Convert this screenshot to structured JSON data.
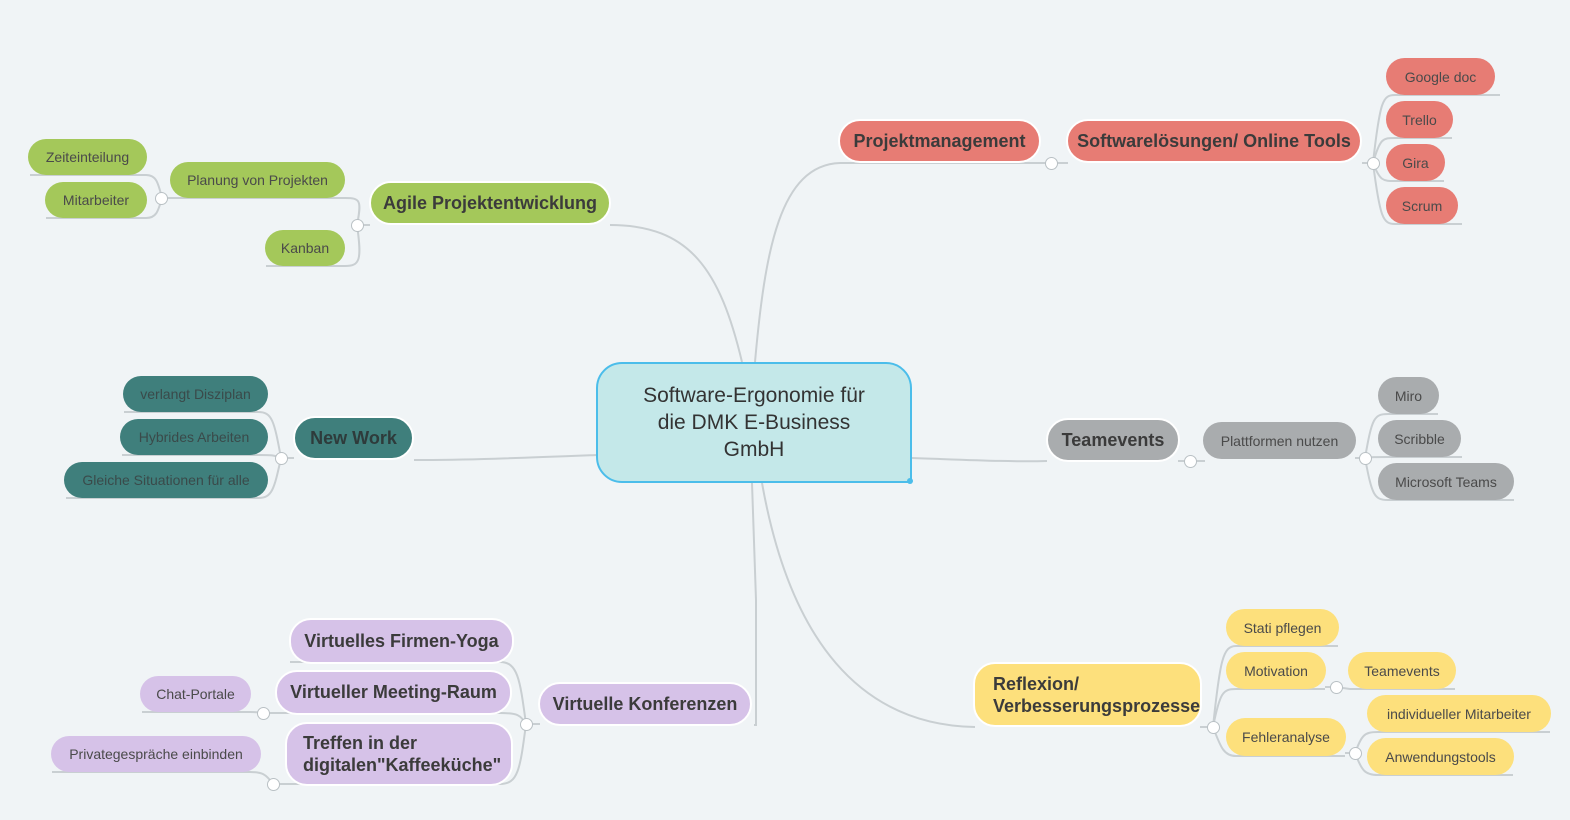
{
  "center": {
    "title": "Software-Ergonomie für die DMK E-Business GmbH"
  },
  "colors": {
    "background": "#f0f4f6",
    "center": "#c4e8e9",
    "center_border": "#4bbdea",
    "agile": "#a4c85a",
    "newwork": "#3f7f7c",
    "virtual": "#d6c2e8",
    "pm": "#e77c74",
    "team": "#a9acae",
    "reflexion": "#fde07c"
  },
  "branches": {
    "agile": {
      "label": "Agile Projektentwicklung",
      "children": {
        "planung": "Planung von Projekten",
        "zeit": "Zeiteinteilung",
        "mitarbeiter": "Mitarbeiter",
        "kanban": "Kanban"
      }
    },
    "newwork": {
      "label": "New Work",
      "children": [
        "verlangt Disziplan",
        "Hybrides Arbeiten",
        "Gleiche Situationen für alle"
      ]
    },
    "virtual": {
      "label": "Virtuelle Konferenzen",
      "children": {
        "yoga": "Virtuelles Firmen-Yoga",
        "meeting": "Virtueller Meeting-Raum",
        "chat": "Chat-Portale",
        "kaffee": "Treffen in der digitalen\"Kaffeeküche\"",
        "privat": "Privategespräche einbinden"
      }
    },
    "pm": {
      "label": "Projektmanagement",
      "software": "Softwarelösungen/ Online Tools",
      "tools": [
        "Google doc",
        "Trello",
        "Gira",
        "Scrum"
      ]
    },
    "team": {
      "label": "Teamevents",
      "plattformen": "Plattformen nutzen",
      "tools": [
        "Miro",
        "Scribble",
        "Microsoft Teams"
      ]
    },
    "reflexion": {
      "label": "Reflexion/ Verbesserungsprozesse",
      "children": {
        "stati": "Stati pflegen",
        "motivation": "Motivation",
        "teamevents": "Teamevents",
        "fehler": "Fehleranalyse",
        "individuell": "individueller Mitarbeiter",
        "anwendung": "Anwendungstools"
      }
    }
  }
}
